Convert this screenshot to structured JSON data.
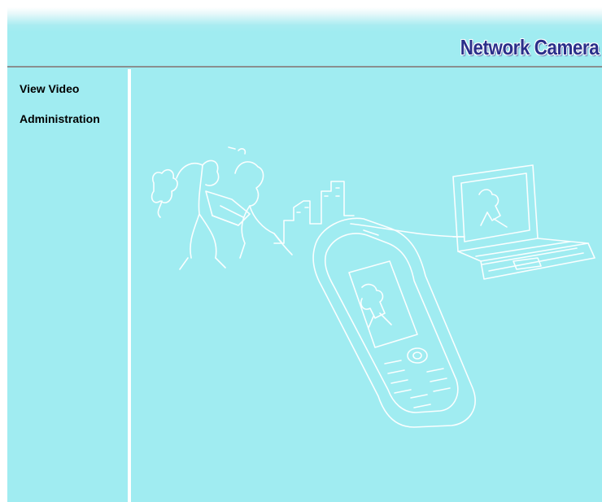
{
  "header": {
    "brand_title": "Network Camera"
  },
  "sidebar": {
    "items": [
      {
        "label": "View Video"
      },
      {
        "label": "Administration"
      }
    ]
  },
  "illustration": {
    "name": "camera-mobile-laptop-illustration"
  },
  "colors": {
    "background": "#a0ecf1",
    "brand_text": "#2a2f8a",
    "rule": "#8a8f90",
    "line_art": "#ffffff"
  }
}
